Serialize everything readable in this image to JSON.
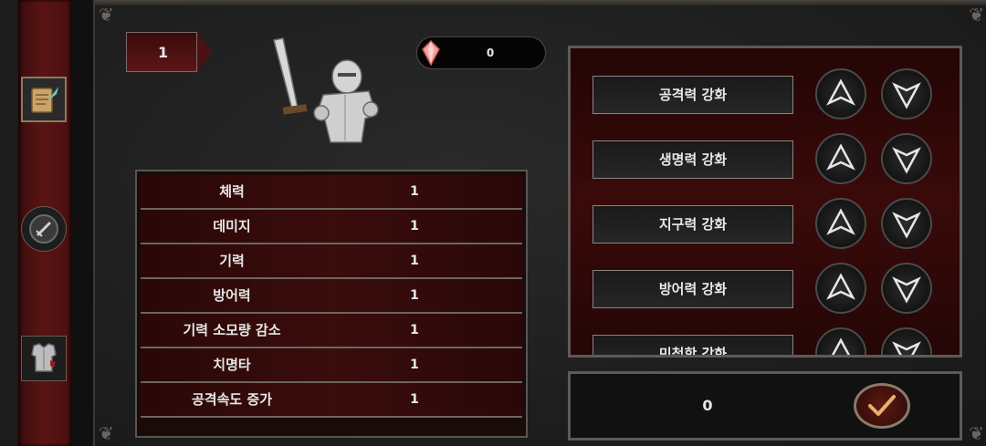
{
  "header": {
    "level": "1",
    "gems": "0"
  },
  "sidebar": {
    "items": [
      {
        "icon": "scroll-quill-icon"
      },
      {
        "icon": "sword-icon"
      },
      {
        "icon": "armor-icon"
      }
    ]
  },
  "stats": [
    {
      "name": "체력",
      "value": "1"
    },
    {
      "name": "데미지",
      "value": "1"
    },
    {
      "name": "기력",
      "value": "1"
    },
    {
      "name": "방어력",
      "value": "1"
    },
    {
      "name": "기력 소모량 감소",
      "value": "1"
    },
    {
      "name": "치명타",
      "value": "1"
    },
    {
      "name": "공격속도 증가",
      "value": "1"
    }
  ],
  "upgrades": [
    {
      "label": "공격력 강화"
    },
    {
      "label": "생명력 강화"
    },
    {
      "label": "지구력 강화"
    },
    {
      "label": "방어력 강화"
    },
    {
      "label": "민첩함 강화"
    }
  ],
  "confirm": {
    "value": "0"
  },
  "colors": {
    "accent_red": "#5a1414",
    "frame": "#5e5a56",
    "text": "#e8e8e8"
  }
}
